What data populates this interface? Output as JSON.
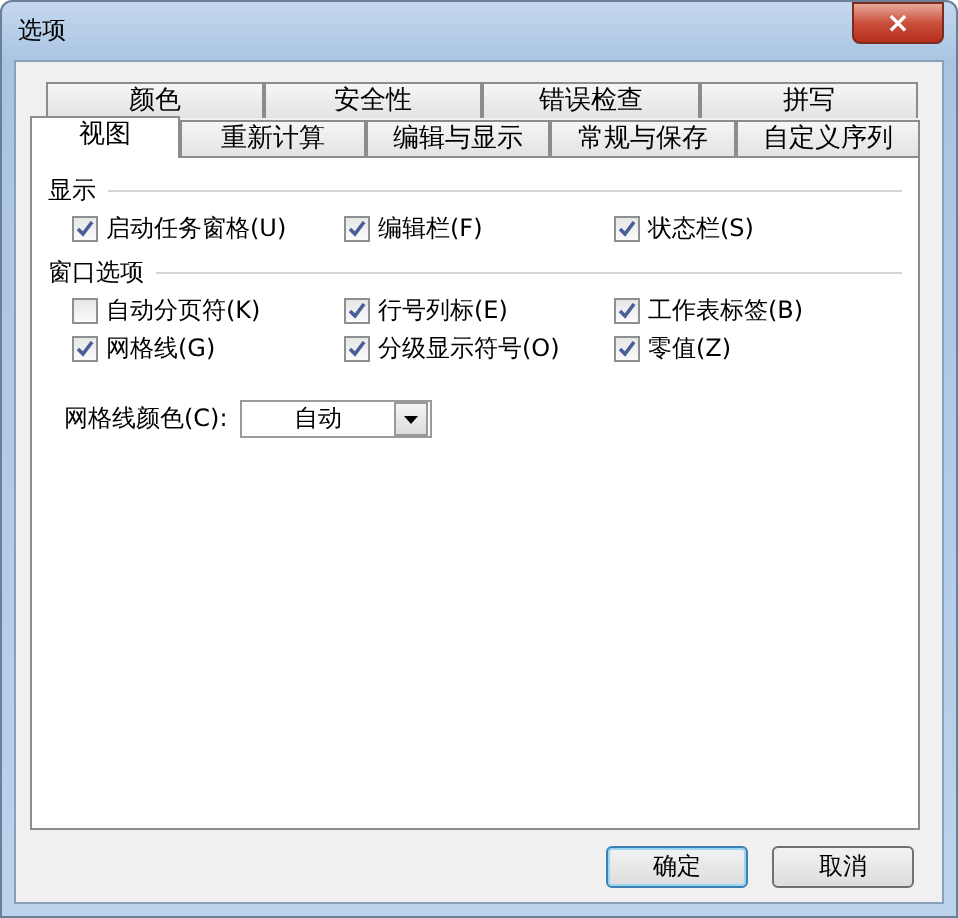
{
  "window": {
    "title": "选项",
    "close_icon": "×"
  },
  "tab_rows": [
    {
      "tabs": [
        {
          "label": "颜色",
          "selected": false
        },
        {
          "label": "安全性",
          "selected": false
        },
        {
          "label": "错误检查",
          "selected": false
        },
        {
          "label": "拼写",
          "selected": false
        }
      ]
    },
    {
      "tabs": [
        {
          "label": "视图",
          "selected": true
        },
        {
          "label": "重新计算",
          "selected": false
        },
        {
          "label": "编辑与显示",
          "selected": false
        },
        {
          "label": "常规与保存",
          "selected": false
        },
        {
          "label": "自定义序列",
          "selected": false
        }
      ]
    }
  ],
  "sections": [
    {
      "title": "显示",
      "options": [
        {
          "label": "启动任务窗格(U)",
          "checked": true
        },
        {
          "label": "编辑栏(F)",
          "checked": true
        },
        {
          "label": "状态栏(S)",
          "checked": true
        }
      ]
    },
    {
      "title": "窗口选项",
      "options": [
        {
          "label": "自动分页符(K)",
          "checked": false
        },
        {
          "label": "行号列标(E)",
          "checked": true
        },
        {
          "label": "工作表标签(B)",
          "checked": true
        },
        {
          "label": "网格线(G)",
          "checked": true
        },
        {
          "label": "分级显示符号(O)",
          "checked": true
        },
        {
          "label": "零值(Z)",
          "checked": true
        }
      ]
    }
  ],
  "gridline_color": {
    "label": "网格线颜色(C):",
    "value": "自动"
  },
  "buttons": [
    {
      "label": "确定",
      "default": true
    },
    {
      "label": "取消",
      "default": false
    }
  ]
}
